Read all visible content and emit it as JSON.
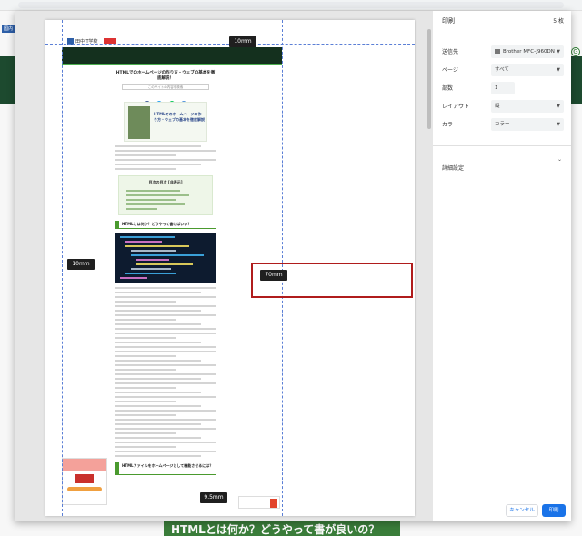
{
  "underlying_page": {
    "logo_text": "国内IT",
    "headline_text": "HTMLとは何か？どうやって書が良いの？"
  },
  "preview": {
    "page_logo_text": "田中IT学校",
    "article_title": "HTMLでのホームページの作り方・ウェブの基本を徹底解説！",
    "search_placeholder": "このサイトの内容を検索",
    "hero_text": "HTMLでのホームページの作り方・ウェブの基本を徹底解説",
    "toc_title": "目次の目次 [非表示]",
    "section1_heading": "HTMLとは何か？どうやって書けばいい？",
    "section2_heading": "HTMLファイルをホームページとして機能させるには？",
    "margins": {
      "top": "10mm",
      "left": "10mm",
      "right": "70mm",
      "bottom": "9.5mm"
    }
  },
  "print_panel": {
    "title": "印刷",
    "sheet_count": "5 枚",
    "destination_label": "送信先",
    "destination_value": "Brother MFC-J960DN",
    "pages_label": "ページ",
    "pages_value": "すべて",
    "copies_label": "部数",
    "copies_value": "1",
    "layout_label": "レイアウト",
    "layout_value": "縦",
    "color_label": "カラー",
    "color_value": "カラー",
    "more_settings_label": "詳細設定",
    "cancel_label": "キャンセル",
    "print_label": "印刷"
  },
  "colors": {
    "accent_blue": "#1a73e8",
    "highlight_red": "#b01c1c",
    "guide_blue": "#5b7fd6",
    "site_green": "#4a9a2e"
  }
}
